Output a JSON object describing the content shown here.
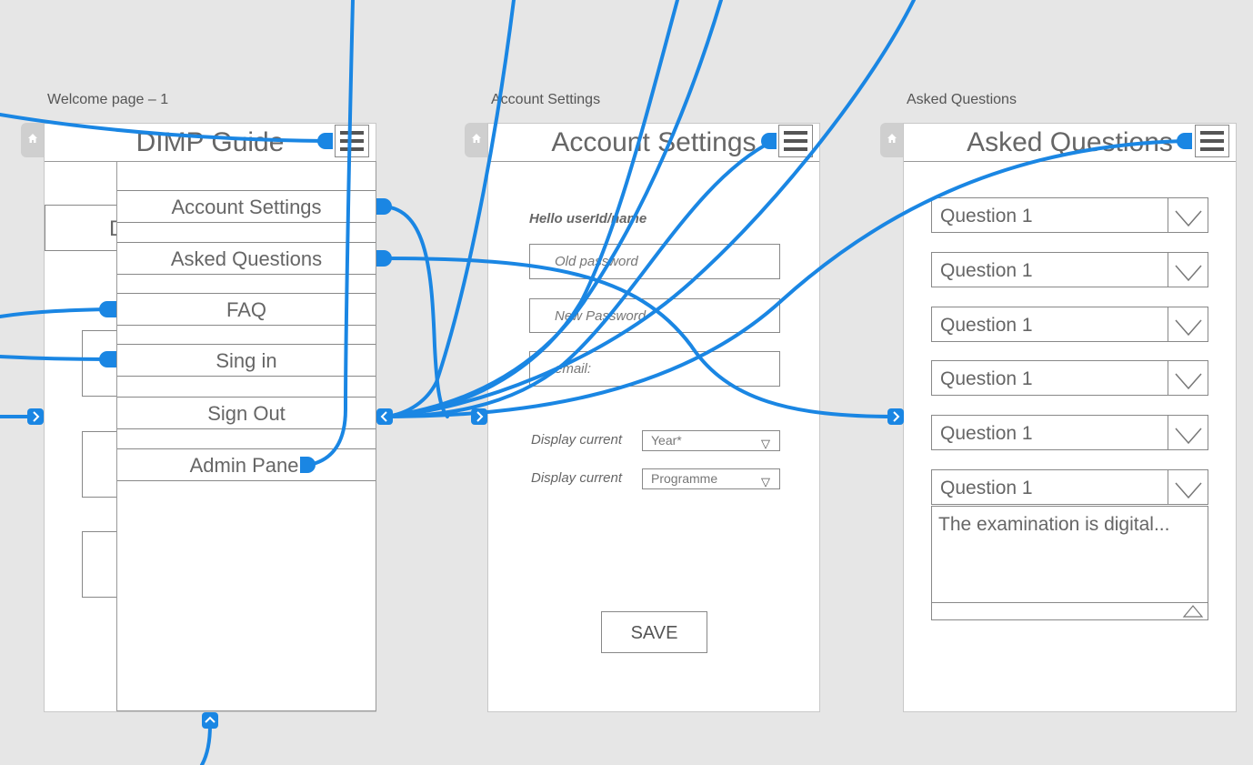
{
  "canvas": {
    "labels": {
      "welcome": "Welcome page – 1",
      "account": "Account Settings",
      "asked": "Asked Questions"
    },
    "link_color": "#1a86e3"
  },
  "welcome": {
    "title": "DIMP Guide",
    "behind_letter": "D",
    "menu": [
      "Account Settings",
      "Asked Questions",
      "FAQ",
      "Sing in",
      "Sign Out",
      "Admin Panel"
    ]
  },
  "account": {
    "title": "Account Settings",
    "greeting": "Hello userId/name",
    "old_password_placeholder": "Old password",
    "new_password_placeholder": "New Password",
    "email_placeholder": "email:",
    "display1_label": "Display current",
    "display1_value": "Year*",
    "display2_label": "Display current",
    "display2_value": "Programme",
    "save_label": "SAVE"
  },
  "asked": {
    "title": "Asked Questions",
    "questions": [
      "Question 1",
      "Question 1",
      "Question 1",
      "Question 1",
      "Question 1",
      "Question 1"
    ],
    "answer": "The examination is digital..."
  },
  "icons": {
    "home": "home-icon",
    "menu": "hamburger-menu-icon",
    "chevron": "chevron-down-icon",
    "nav": "navigation-arrow-icon"
  }
}
